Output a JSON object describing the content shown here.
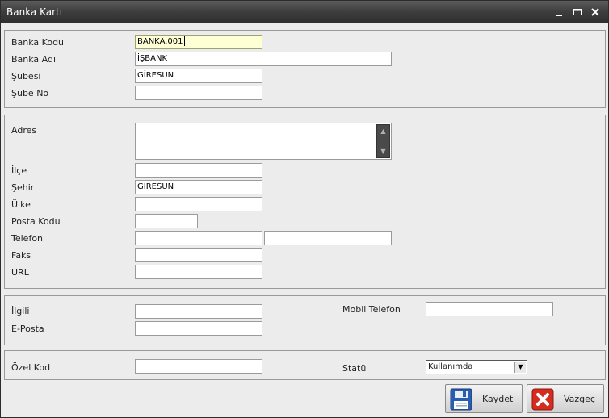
{
  "window": {
    "title": "Banka Kartı"
  },
  "labels": {
    "banka_kodu": "Banka Kodu",
    "banka_adi": "Banka Adı",
    "subesi": "Şubesi",
    "sube_no": "Şube No",
    "adres": "Adres",
    "ilce": "İlçe",
    "sehir": "Şehir",
    "ulke": "Ülke",
    "posta_kodu": "Posta Kodu",
    "telefon": "Telefon",
    "faks": "Faks",
    "url": "URL",
    "ilgili": "İlgili",
    "e_posta": "E-Posta",
    "mobil_telefon": "Mobil Telefon",
    "ozel_kod": "Özel Kod",
    "statu": "Statü"
  },
  "values": {
    "banka_kodu": "BANKA.001",
    "banka_adi": "İŞBANK",
    "subesi": "GİRESUN",
    "sube_no": "",
    "adres": "",
    "ilce": "",
    "sehir": "GİRESUN",
    "ulke": "",
    "posta_kodu": "",
    "telefon1": "",
    "telefon2": "",
    "faks": "",
    "url": "",
    "ilgili": "",
    "e_posta": "",
    "mobil_telefon": "",
    "ozel_kod": "",
    "statu": "Kullanımda"
  },
  "buttons": {
    "save": "Kaydet",
    "cancel": "Vazgeç"
  },
  "icons": {
    "minimize": "minimize-icon",
    "maximize": "maximize-icon",
    "close": "close-icon",
    "save": "floppy-disk-icon",
    "cancel": "red-x-icon"
  },
  "colors": {
    "titlebar": "#3d3d3d",
    "focus_field": "#ffffd6",
    "cancel_icon": "#d62b1f",
    "save_icon": "#2a5db0"
  }
}
